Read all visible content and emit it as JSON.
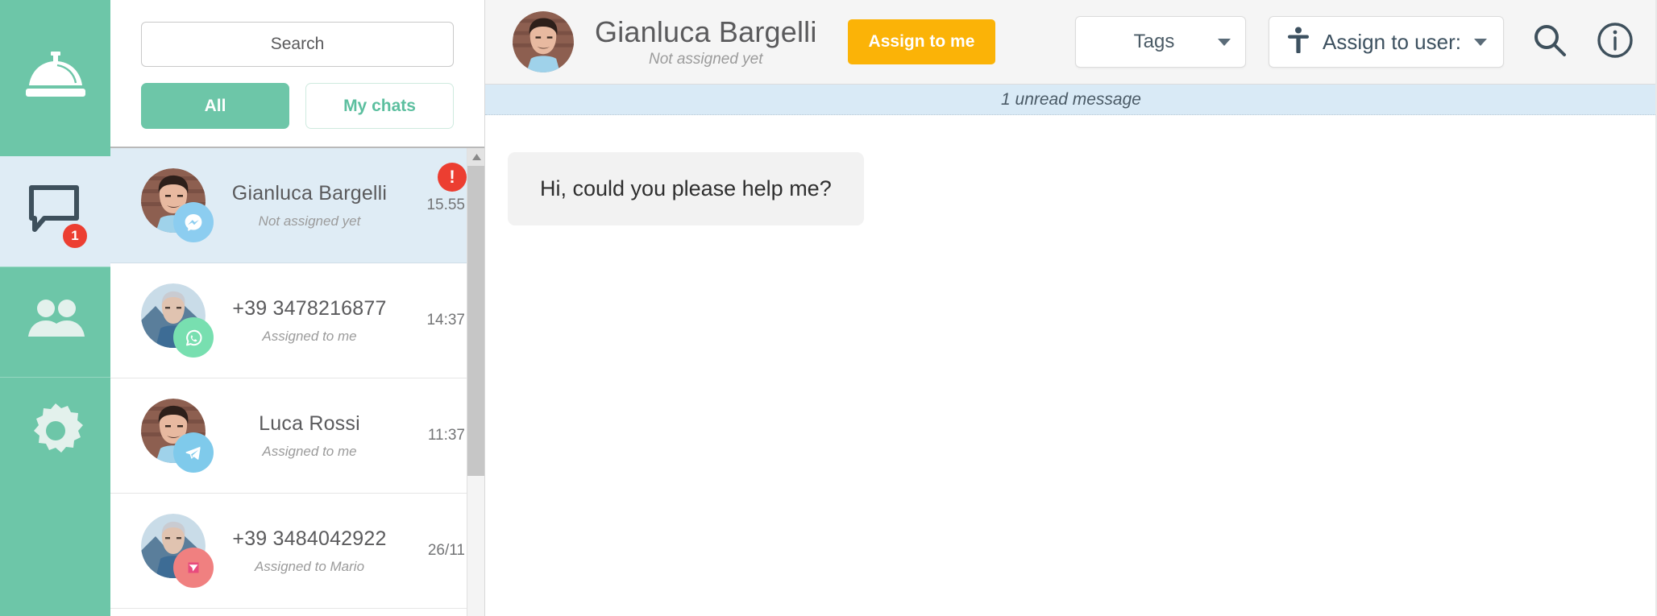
{
  "rail": {
    "logo_icon": "service-bell-icon",
    "items": [
      {
        "id": "chats",
        "icon": "chat-bubble-icon",
        "active": true,
        "badge": "1"
      },
      {
        "id": "contacts",
        "icon": "users-icon",
        "active": false,
        "badge": ""
      },
      {
        "id": "settings",
        "icon": "gear-icon",
        "active": false,
        "badge": ""
      }
    ]
  },
  "list": {
    "search_placeholder": "Search",
    "search_value": "",
    "tab_all": "All",
    "tab_mine": "My chats",
    "active_tab": "All",
    "rows": [
      {
        "name": "Gianluca Bargelli",
        "status": "Not assigned yet",
        "time": "15.55",
        "channel": "messenger",
        "alert": "!",
        "selected": true
      },
      {
        "name": "+39 3478216877",
        "status": "Assigned to me",
        "time": "14:37",
        "channel": "whatsapp",
        "alert": "",
        "selected": false
      },
      {
        "name": "Luca Rossi",
        "status": "Assigned to me",
        "time": "11:37",
        "channel": "telegram",
        "alert": "",
        "selected": false
      },
      {
        "name": "+39 3484042922",
        "status": "Assigned to Mario",
        "time": "26/11",
        "channel": "instagram",
        "alert": "",
        "selected": false
      }
    ]
  },
  "header": {
    "title": "Gianluca Bargelli",
    "subtitle": "Not assigned yet",
    "assign_button": "Assign to me",
    "tags_label": "Tags",
    "assign_user_label": "Assign to user:",
    "search_icon": "search-icon",
    "info_icon": "info-circle-icon",
    "accessibility_icon": "person-icon"
  },
  "conversation": {
    "unread_notice": "1 unread message",
    "messages": [
      {
        "text": "Hi, could you please help me?",
        "from": "them"
      }
    ]
  },
  "colors": {
    "brand_green": "#6dc6a8",
    "selected_blue": "#dfecf5",
    "alert_red": "#ec3e31",
    "assign_orange": "#fbb307",
    "unread_bar": "#d9eaf6"
  }
}
